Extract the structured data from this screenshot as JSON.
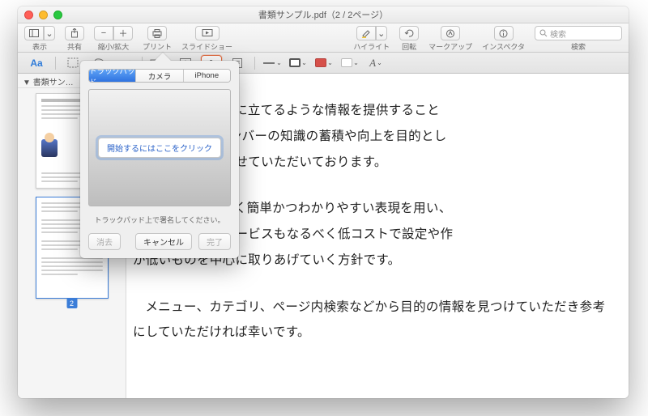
{
  "window": {
    "title": "書類サンプル.pdf（2 / 2ページ）"
  },
  "toolbar": {
    "view_label": "表示",
    "share_label": "共有",
    "zoom_label": "縮小/拡大",
    "print_label": "プリント",
    "slideshow_label": "スライドショー",
    "highlight_label": "ハイライト",
    "rotate_label": "回転",
    "markup_label": "マークアップ",
    "inspector_label": "インスペクタ",
    "search_placeholder": "検索",
    "search_label": "検索"
  },
  "markupbar": {
    "text_tool": "Aa",
    "shape_swatch": "#d6504a"
  },
  "sidebar": {
    "header": "書類サン…",
    "page2_num": "2"
  },
  "document": {
    "p1a": "しでも皆様のお役に立てるような情報を提供すること",
    "p1b": "々i-TSUNAGUメンバーの知識の蓄積や向上を目的とし",
    "p1c": "りサイトを運営させていただいております。",
    "p2a": "ましても、なるべく簡単かつわかりやすい表現を用い、",
    "p2b": "る方法や商品・サービスもなるべく低コストで設定や作",
    "p2c": "が低いものを中心に取りあげていく方針です。",
    "p3": "メニュー、カテゴリ、ページ内検索などから目的の情報を見つけていただき参考にしていただければ幸いです。"
  },
  "signature_popover": {
    "tabs": {
      "trackpad": "トラックパッド",
      "camera": "カメラ",
      "iphone": "iPhone"
    },
    "start_button": "開始するにはここをクリック",
    "hint": "トラックパッド上で署名してください。",
    "clear": "消去",
    "cancel": "キャンセル",
    "done": "完了"
  }
}
